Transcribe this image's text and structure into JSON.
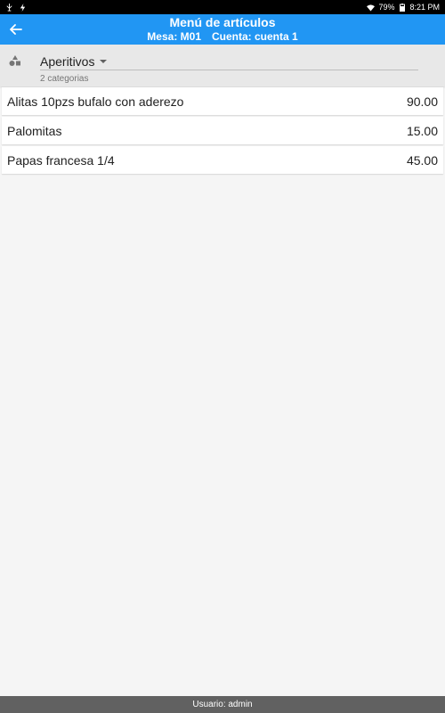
{
  "status_bar": {
    "battery": "79%",
    "time": "8:21 PM"
  },
  "app_bar": {
    "title": "Menú de artículos",
    "table": "Mesa: M01",
    "account": "Cuenta: cuenta 1"
  },
  "category": {
    "selected": "Aperitivos",
    "count_text": "2 categorias"
  },
  "items": [
    {
      "name": "Alitas 10pzs bufalo con aderezo",
      "price": "90.00"
    },
    {
      "name": "Palomitas",
      "price": "15.00"
    },
    {
      "name": "Papas francesa 1/4",
      "price": "45.00"
    }
  ],
  "footer": {
    "user": "Usuario: admin"
  },
  "colors": {
    "app_bar": "#2196f3",
    "footer": "#616161",
    "status_bar": "#000000"
  }
}
